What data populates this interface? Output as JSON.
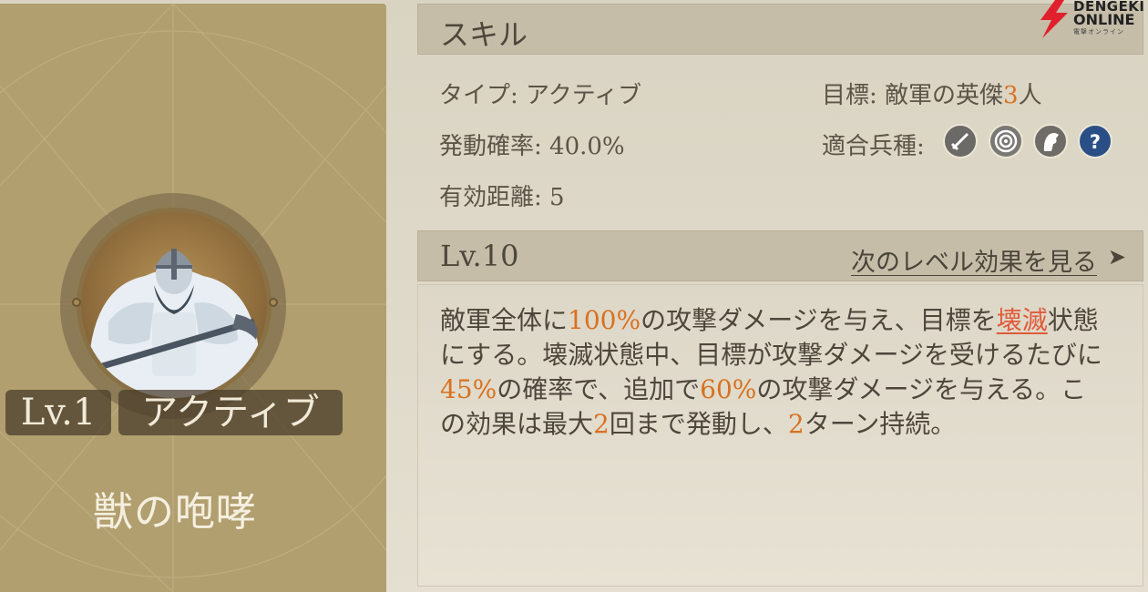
{
  "card": {
    "level_tag": "Lv.1",
    "type_tag": "アクティブ",
    "skill_name": "獣の咆哮"
  },
  "skill_section": {
    "title": "スキル"
  },
  "stats": {
    "type": "タイプ: アクティブ",
    "target_prefix": "目標: 敵軍の英傑",
    "target_count": "3",
    "target_suffix": "人",
    "activation_rate": "発動確率: 40.0%",
    "effective_range": "有効距離: 5",
    "troop_label": "適合兵種:"
  },
  "troop_types": [
    {
      "icon": "sword-icon",
      "color": "#6c6a66"
    },
    {
      "icon": "target-icon",
      "color": "#7a7874"
    },
    {
      "icon": "horse-icon",
      "color": "#6f6c68"
    },
    {
      "icon": "question-icon",
      "color": "#2a4f86"
    }
  ],
  "level_section": {
    "level": "Lv.10",
    "next_link": "次のレベル効果を見る",
    "arrow": "➤"
  },
  "description": {
    "l1_a": "敵軍全体に",
    "l1_b": "100%",
    "l1_c": "の攻撃ダメージを与え、目標を",
    "l1_d": "壊滅",
    "l1_e": "状態",
    "l2": "にする。壊滅状態中、目標が攻撃ダメージを受けるたびに",
    "l3_a": "45%",
    "l3_b": "の確率で、追加で",
    "l3_c": "60%",
    "l3_d": "の攻撃ダメージを与える。こ",
    "l4_a": "の効果は最大",
    "l4_b": "2",
    "l4_c": "回まで発動し、",
    "l4_d": "2",
    "l4_e": "ターン持続。"
  },
  "logo": {
    "line1": "DENGEKI",
    "line2": "ONLINE",
    "line3": "電撃オンライン"
  },
  "colors": {
    "highlight": "#d9711f",
    "keyword": "#e05b3a",
    "card": "#b19f70"
  }
}
